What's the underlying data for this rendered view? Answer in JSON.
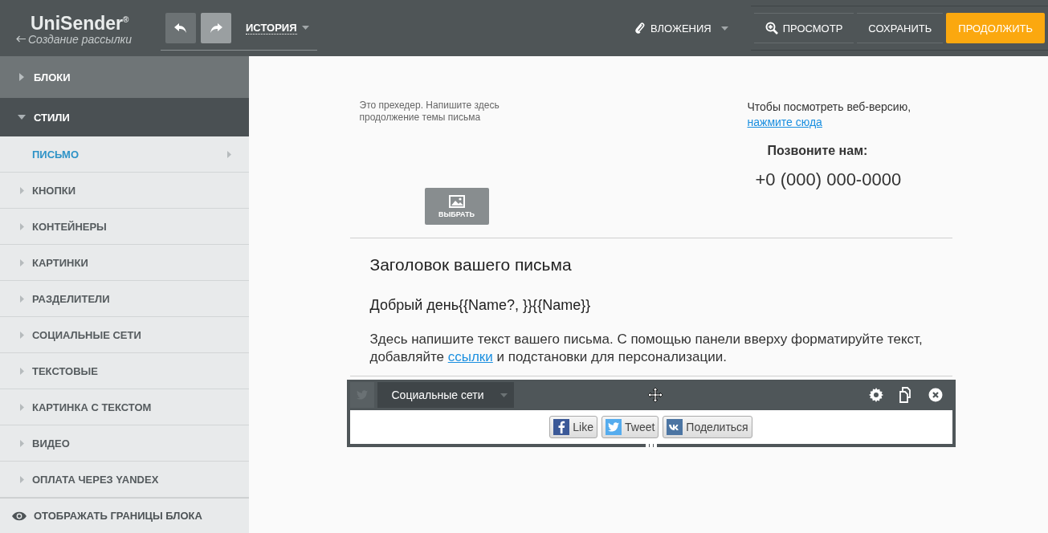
{
  "header": {
    "logo": "UniSender",
    "logo_mark": "®",
    "back_link": "Создание рассылки",
    "history": "ИСТОРИЯ",
    "attachments": "ВЛОЖЕНИЯ",
    "preview": "ПРОСМОТР",
    "save": "СОХРАНИТЬ",
    "continue": "ПРОДОЛЖИТЬ"
  },
  "sidebar": {
    "sections": [
      {
        "label": "БЛОКИ",
        "expanded": false
      },
      {
        "label": "СТИЛИ",
        "expanded": true,
        "children": [
          {
            "label": "ПИСЬМО",
            "selected": true
          },
          {
            "label": "КНОПКИ",
            "selected": false
          },
          {
            "label": "КОНТЕЙНЕРЫ",
            "selected": false
          },
          {
            "label": "КАРТИНКИ",
            "selected": false
          },
          {
            "label": "РАЗДЕЛИТЕЛИ",
            "selected": false
          },
          {
            "label": "СОЦИАЛЬНЫЕ СЕТИ",
            "selected": false
          },
          {
            "label": "ТЕКСТОВЫЕ",
            "selected": false
          },
          {
            "label": "КАРТИНКА С ТЕКСТОМ",
            "selected": false
          },
          {
            "label": "ВИДЕО",
            "selected": false
          },
          {
            "label": "ОПЛАТА ЧЕРЕЗ YANDEX",
            "selected": false
          }
        ]
      }
    ],
    "toggle": "ОТОБРАЖАТЬ ГРАНИЦЫ БЛОКА"
  },
  "email": {
    "preheader": "Это прехедер. Напишите здесь продолжение темы письма",
    "web_version": {
      "text": "Чтобы посмотреть веб-версию,",
      "link": "нажмите сюда"
    },
    "image_button": "ВЫБРАТЬ",
    "call_label": "Позвоните нам:",
    "phone": "+0 (000) 000-0000",
    "heading": "Заголовок вашего письма",
    "greeting": "Добрый день{{Name?, }}{{Name}}",
    "body": {
      "before": "Здесь напишите текст вашего письма. С помощью панели вверху форматируйте текст, добавляйте ",
      "link": "ссылки",
      "after": " и подстановки для персонализации."
    }
  },
  "social_block": {
    "block_type": "Социальные сети",
    "buttons": [
      {
        "kind": "facebook",
        "label": "Like"
      },
      {
        "kind": "twitter",
        "label": "Tweet"
      },
      {
        "kind": "vk",
        "label": "Поделиться"
      }
    ]
  }
}
